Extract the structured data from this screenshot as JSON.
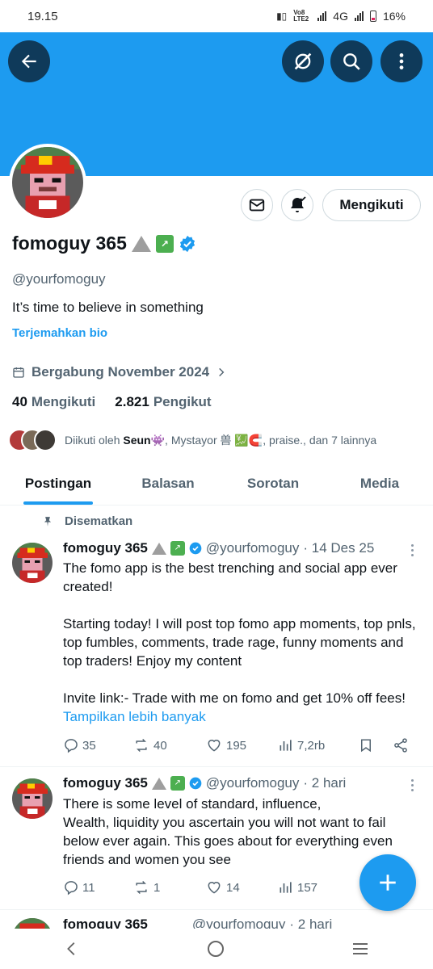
{
  "status_bar": {
    "time": "19.15",
    "volte": "Vo8 LTE2",
    "network": "4G",
    "battery": "16%"
  },
  "profile": {
    "name": "fomoguy 365",
    "name_emojis": [
      "mountain",
      "chart"
    ],
    "verified": true,
    "handle": "@yourfomoguy",
    "bio": "It’s time to believe in something",
    "translate_bio": "Terjemahkan bio",
    "joined": "Bergabung November 2024",
    "following_count": "40",
    "following_label": "Mengikuti",
    "followers_count": "2.821",
    "followers_label": "Pengikut",
    "followed_by_prefix": "Diikuti oleh",
    "followed_by_name": "Seun👾",
    "followed_by_rest": ", Mystayor 兽 💹🧲, praise., dan 7 lainnya",
    "follow_button": "Mengikuti"
  },
  "tabs": [
    "Postingan",
    "Balasan",
    "Sorotan",
    "Media"
  ],
  "active_tab": "Postingan",
  "pinned_label": "Disematkan",
  "posts": [
    {
      "name": "fomoguy 365",
      "handle": "@yourfomoguy",
      "time": "· 14 Des 25",
      "text": "The fomo app is the best trenching and social app ever created!\n\nStarting today! I will post top fomo app moments, top pnls, top fumbles, comments, trade rage, funny moments and top traders! Enjoy my content\n\nInvite link:- Trade with me on fomo and get 10% off fees!",
      "show_more": "Tampilkan lebih banyak",
      "replies": "35",
      "reposts": "40",
      "likes": "195",
      "views": "7,2rb"
    },
    {
      "name": "fomoguy 365",
      "handle": "@yourfomoguy",
      "time": "· 2 hari",
      "text": "There is some level of standard, influence,\nWealth, liquidity you ascertain you will not want to fail below ever again. This goes about for everything even friends and women you see",
      "replies": "11",
      "reposts": "1",
      "likes": "14",
      "views": "157"
    },
    {
      "name": "fomoguy 365",
      "handle": "@yourfomoguy",
      "time": "· 2 hari"
    }
  ],
  "colors": {
    "banner": "#1d9bf0",
    "accent": "#1d9bf0",
    "verified": "#1d9bf0",
    "text": "#0f1419",
    "muted": "#536471"
  }
}
